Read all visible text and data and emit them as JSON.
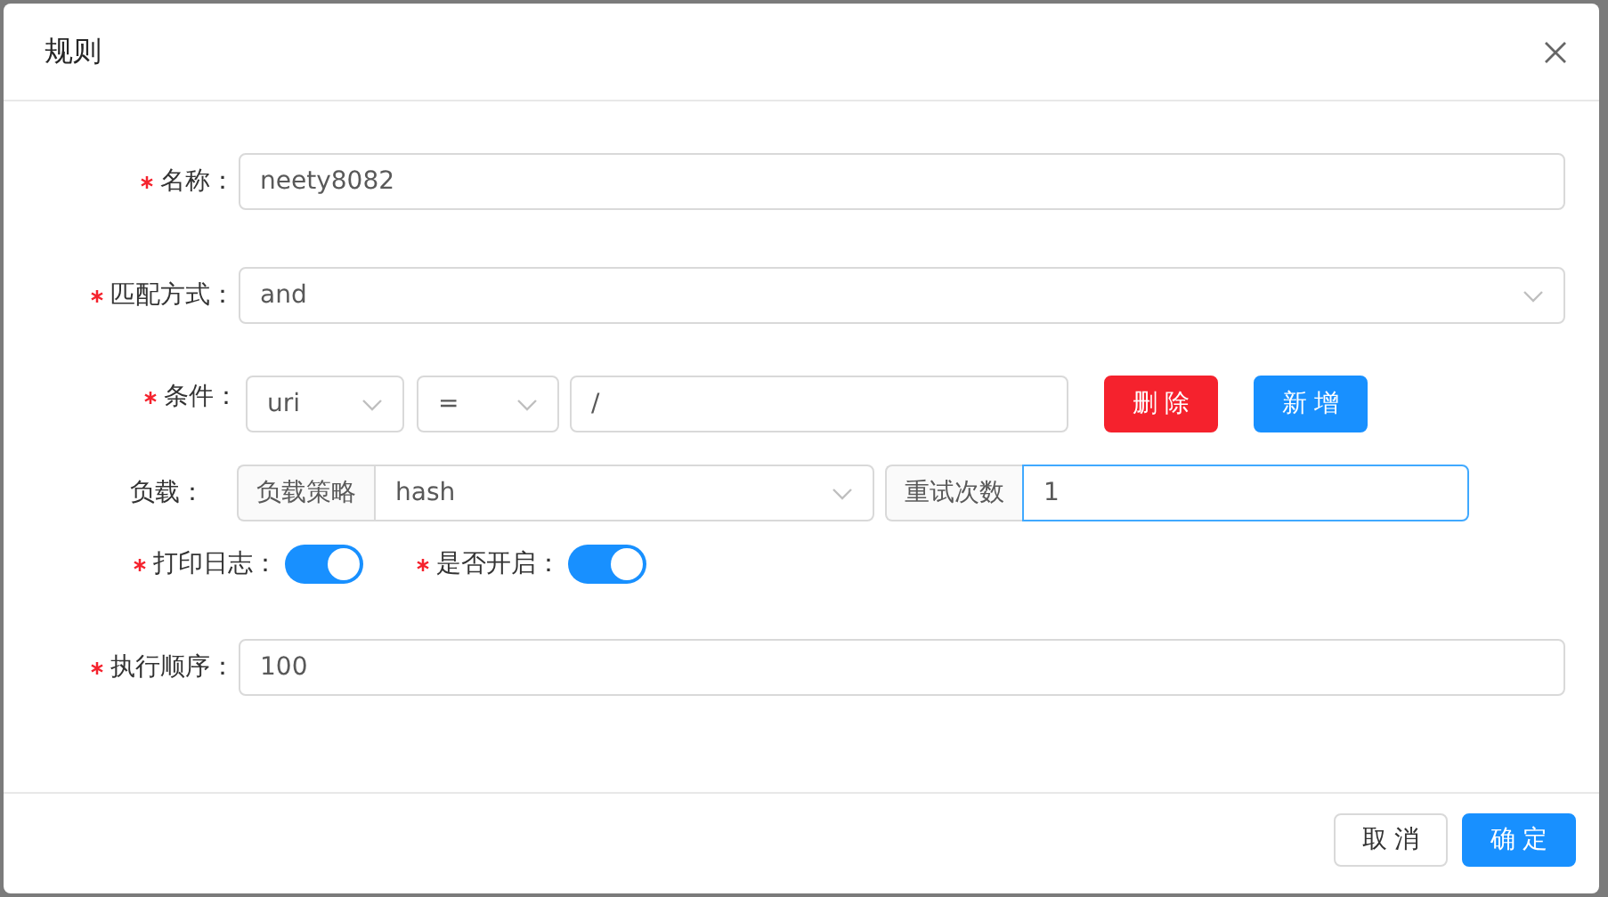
{
  "dialog": {
    "title": "规则"
  },
  "name_field": {
    "label": "名称：",
    "required": true,
    "value": "neety8082"
  },
  "match_field": {
    "label": "匹配方式：",
    "required": true,
    "value": "and"
  },
  "condition": {
    "label": "条件：",
    "required": true,
    "key_value": "uri",
    "operator_value": "=",
    "path_value": "/",
    "buttons": [
      {
        "label": "删 除",
        "kind": "danger"
      },
      {
        "label": "新 增",
        "kind": "primary"
      }
    ]
  },
  "load": {
    "label": "负载：",
    "required": false,
    "strategy_addon": "负载策略",
    "strategy_value": "hash",
    "retry_addon": "重试次数",
    "retry_value": "1",
    "retry_focused": true
  },
  "switches": [
    {
      "label": "打印日志：",
      "required": true,
      "on": true
    },
    {
      "label": "是否开启：",
      "required": true,
      "on": true
    }
  ],
  "order_field": {
    "label": "执行顺序：",
    "required": true,
    "value": "100"
  },
  "footer_buttons": [
    {
      "label": "取 消",
      "kind": "default"
    },
    {
      "label": "确 定",
      "kind": "primary"
    }
  ]
}
